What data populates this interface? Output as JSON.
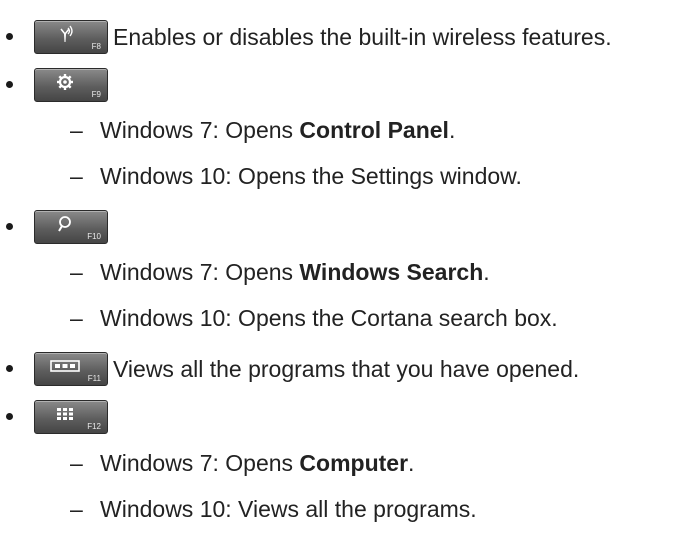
{
  "items": [
    {
      "key_label": "F8",
      "icon": "wireless-icon",
      "text": "Enables or disables the built-in wireless features."
    },
    {
      "key_label": "F9",
      "icon": "gear-icon",
      "subitems": [
        {
          "prefix": "Windows 7: Opens ",
          "bold": "Control Panel",
          "suffix": "."
        },
        {
          "prefix": "Windows 10: Opens the Settings window.",
          "bold": "",
          "suffix": ""
        }
      ]
    },
    {
      "key_label": "F10",
      "icon": "search-icon",
      "subitems": [
        {
          "prefix": "Windows 7: Opens ",
          "bold": "Windows Search",
          "suffix": "."
        },
        {
          "prefix": "Windows 10: Opens the Cortana search box.",
          "bold": "",
          "suffix": ""
        }
      ]
    },
    {
      "key_label": "F11",
      "icon": "task-view-icon",
      "text": "Views all the programs that you have opened."
    },
    {
      "key_label": "F12",
      "icon": "apps-grid-icon",
      "subitems": [
        {
          "prefix": "Windows 7: Opens ",
          "bold": "Computer",
          "suffix": "."
        },
        {
          "prefix": "Windows 10: Views all the programs.",
          "bold": "",
          "suffix": ""
        }
      ]
    }
  ],
  "dash": "–"
}
